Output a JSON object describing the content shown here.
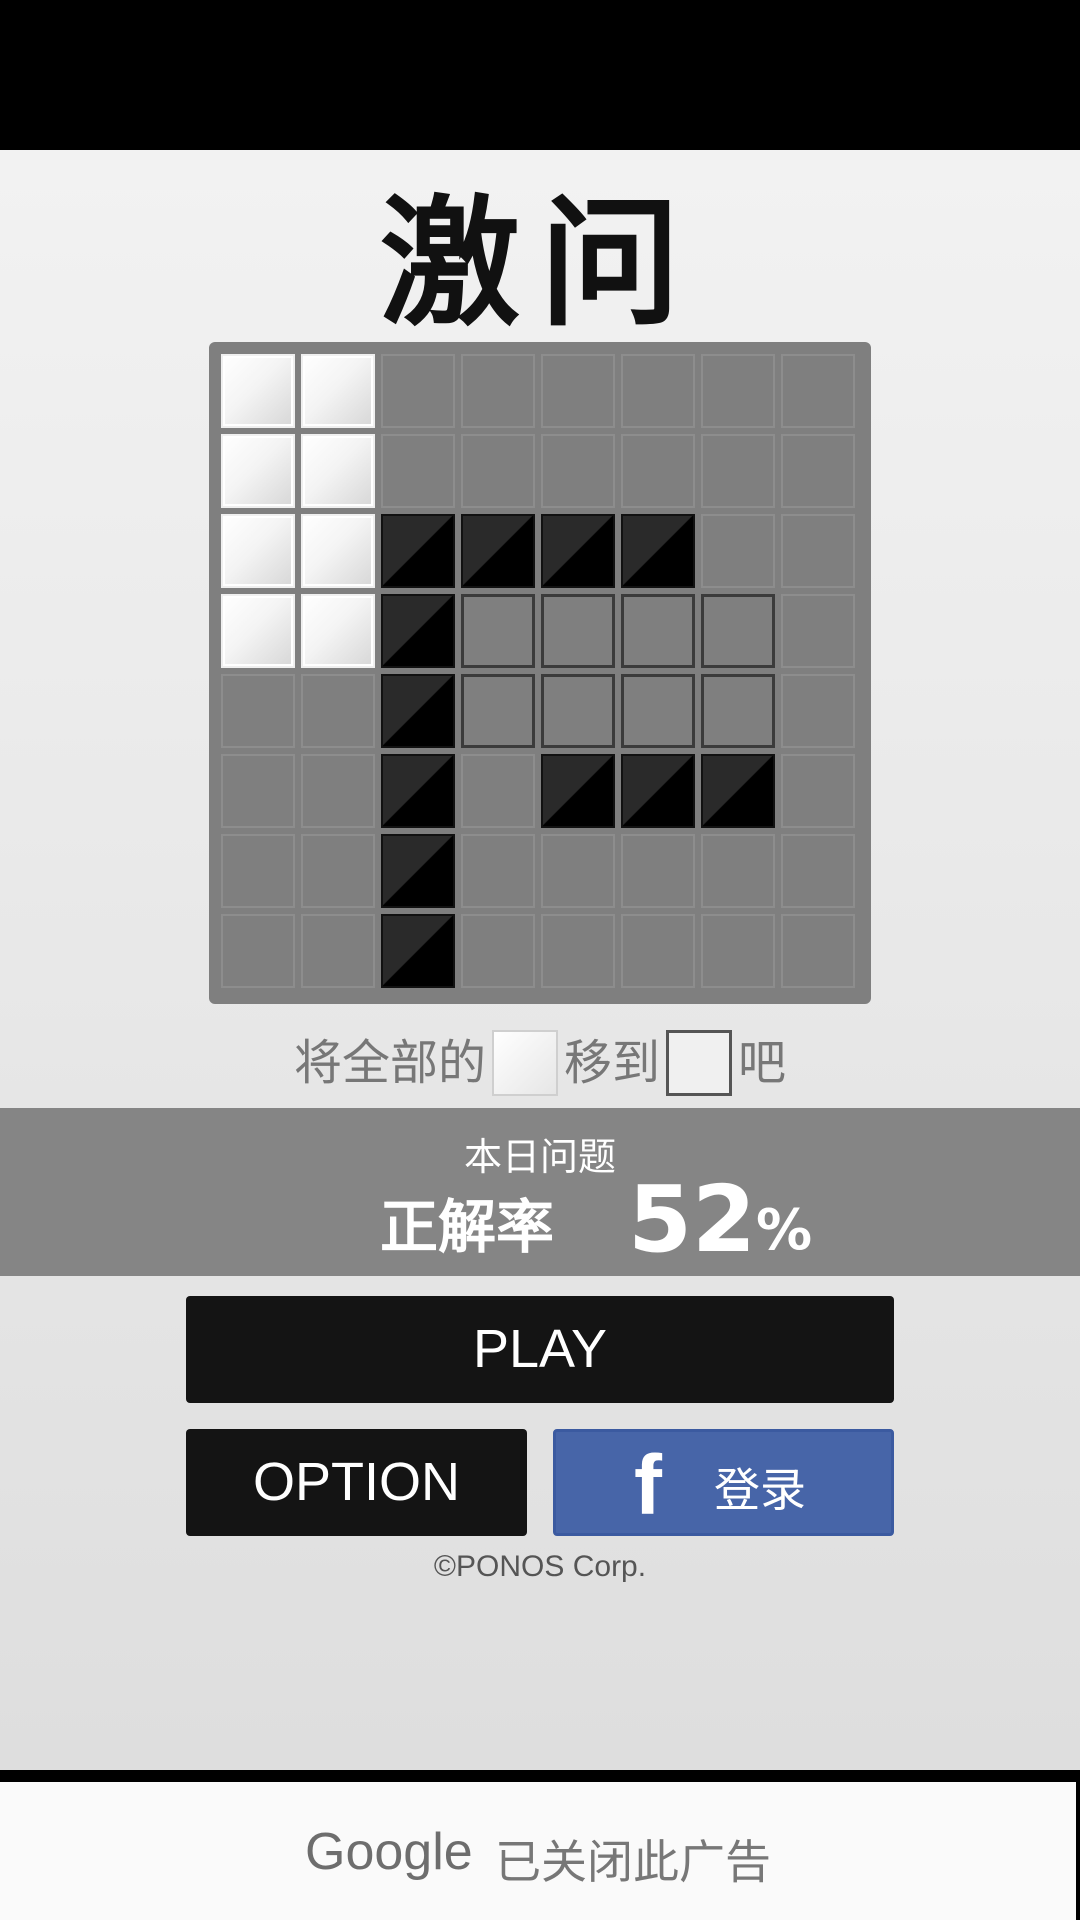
{
  "game": {
    "title": "激问",
    "instruction": {
      "part1": "将全部的",
      "part2": "移到",
      "part3": "吧"
    },
    "board": {
      "rows": 8,
      "cols": 8,
      "cells": [
        [
          "white",
          "white",
          "empty",
          "empty",
          "empty",
          "empty",
          "empty",
          "empty"
        ],
        [
          "white",
          "white",
          "empty",
          "empty",
          "empty",
          "empty",
          "empty",
          "empty"
        ],
        [
          "white",
          "white",
          "black",
          "black",
          "black",
          "black",
          "empty",
          "empty"
        ],
        [
          "white",
          "white",
          "black",
          "target",
          "target",
          "target",
          "target",
          "empty"
        ],
        [
          "empty",
          "empty",
          "black",
          "target",
          "target",
          "target",
          "target",
          "empty"
        ],
        [
          "empty",
          "empty",
          "black",
          "empty",
          "black",
          "black",
          "black",
          "empty"
        ],
        [
          "empty",
          "empty",
          "black",
          "empty",
          "empty",
          "empty",
          "empty",
          "empty"
        ],
        [
          "empty",
          "empty",
          "black",
          "empty",
          "empty",
          "empty",
          "empty",
          "empty"
        ]
      ]
    }
  },
  "daily": {
    "label": "本日问题",
    "rate_label": "正解率",
    "rate_value": "52",
    "rate_unit": "%"
  },
  "buttons": {
    "play": "PLAY",
    "option": "OPTION",
    "facebook_icon": "f",
    "facebook_login": "登录"
  },
  "copyright": "©PONOS Corp.",
  "ad": {
    "brand": "Google",
    "closed_text": "已关闭此广告"
  },
  "colors": {
    "board_bg": "#7f7f7f",
    "daily_band": "#858585",
    "button_dark": "#141414",
    "facebook_blue": "#4765a8"
  }
}
